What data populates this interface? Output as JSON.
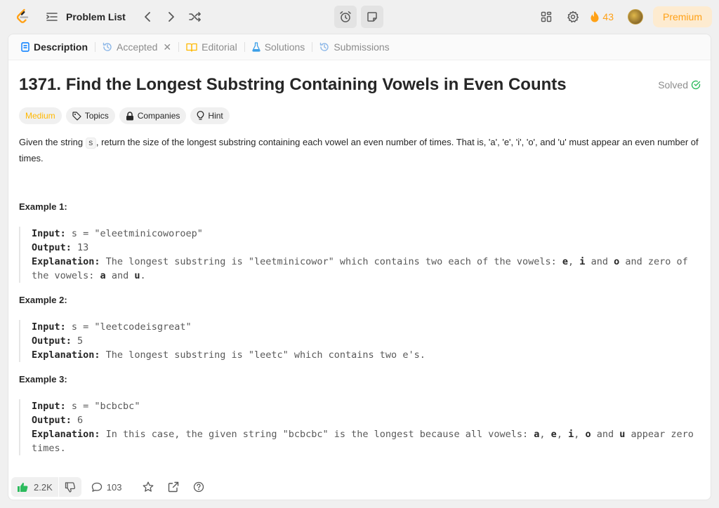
{
  "nav": {
    "problem_list_label": "Problem List",
    "streak_count": "43",
    "premium_label": "Premium"
  },
  "tabs": [
    {
      "label": "Description"
    },
    {
      "label": "Accepted"
    },
    {
      "label": "Editorial"
    },
    {
      "label": "Solutions"
    },
    {
      "label": "Submissions"
    }
  ],
  "problem": {
    "title": "1371. Find the Longest Substring Containing Vowels in Even Counts",
    "status": "Solved",
    "difficulty": "Medium",
    "chips": [
      "Topics",
      "Companies",
      "Hint"
    ],
    "desc_part1": "Given the string ",
    "desc_code": "s",
    "desc_part2": ", return the size of the longest substring containing each vowel an even number of times. That is, 'a', 'e', 'i', 'o', and 'u' must appear an even number of times."
  },
  "examples": [
    {
      "title": "Example 1:",
      "input_label": "Input:",
      "input": " s = \"eleetminicoworoep\"",
      "output_label": "Output:",
      "output": " 13",
      "explanation_label": "Explanation:",
      "exp_a": " The longest substring is \"leetminicowor\" which contains two each of the vowels: ",
      "exp_v1": "e",
      "exp_s1": ", ",
      "exp_v2": "i",
      "exp_s2": " and ",
      "exp_v3": "o",
      "exp_b": " and zero of the vowels: ",
      "exp_v4": "a",
      "exp_s3": " and ",
      "exp_v5": "u",
      "exp_end": "."
    },
    {
      "title": "Example 2:",
      "input_label": "Input:",
      "input": " s = \"leetcodeisgreat\"",
      "output_label": "Output:",
      "output": " 5",
      "explanation_label": "Explanation:",
      "exp_a": " The longest substring is \"leetc\" which contains two e's."
    },
    {
      "title": "Example 3:",
      "input_label": "Input:",
      "input": " s = \"bcbcbc\"",
      "output_label": "Output:",
      "output": " 6",
      "explanation_label": "Explanation:",
      "exp_a": " In this case, the given string \"bcbcbc\" is the longest because all vowels: ",
      "exp_v1": "a",
      "exp_s1": ", ",
      "exp_v2": "e",
      "exp_s2": ", ",
      "exp_v3": "i",
      "exp_s3": ", ",
      "exp_v4": "o",
      "exp_s4": " and ",
      "exp_v5": "u",
      "exp_b": " appear zero times."
    }
  ],
  "footer": {
    "likes": "2.2K",
    "comments": "103"
  },
  "colors": {
    "accent": "#ffa116",
    "medium": "#ffb800",
    "solved": "#2cbb5d",
    "like": "#2cbb5d"
  }
}
